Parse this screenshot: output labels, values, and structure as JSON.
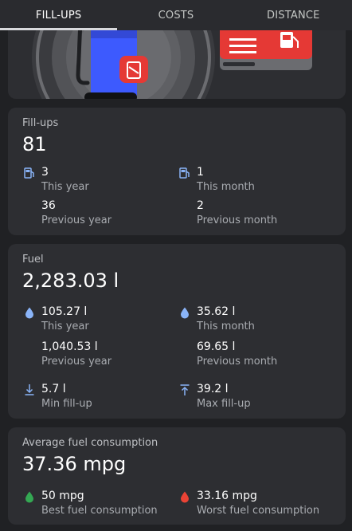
{
  "tabs": [
    {
      "label": "FILL-UPS",
      "active": true
    },
    {
      "label": "COSTS",
      "active": false
    },
    {
      "label": "DISTANCE",
      "active": false
    }
  ],
  "colors": {
    "background": "#202124",
    "card": "#2d2e32",
    "accent_blue": "#8ab4f8",
    "best": "#34a853",
    "worst": "#ea4335",
    "pump_blue": "#3d5afe",
    "red": "#e53935"
  },
  "fillups": {
    "label": "Fill-ups",
    "value": "81",
    "icon": "gas-pump-icon",
    "this_year": {
      "value": "3",
      "label": "This year"
    },
    "this_month": {
      "value": "1",
      "label": "This month"
    },
    "previous_year": {
      "value": "36",
      "label": "Previous year"
    },
    "previous_month": {
      "value": "2",
      "label": "Previous month"
    }
  },
  "fuel": {
    "label": "Fuel",
    "value": "2,283.03 l",
    "icon": "droplet-icon",
    "this_year": {
      "value": "105.27 l",
      "label": "This year"
    },
    "this_month": {
      "value": "35.62 l",
      "label": "This month"
    },
    "previous_year": {
      "value": "1,040.53 l",
      "label": "Previous year"
    },
    "previous_month": {
      "value": "69.65 l",
      "label": "Previous month"
    },
    "min": {
      "value": "5.7 l",
      "label": "Min fill-up",
      "icon": "arrow-down-to-line-icon"
    },
    "max": {
      "value": "39.2 l",
      "label": "Max fill-up",
      "icon": "arrow-up-to-line-icon"
    }
  },
  "consumption": {
    "label": "Average fuel consumption",
    "value": "37.36 mpg",
    "best": {
      "value": "50 mpg",
      "label": "Best fuel consumption",
      "icon": "droplet-green-icon"
    },
    "worst": {
      "value": "33.16 mpg",
      "label": "Worst fuel consumption",
      "icon": "droplet-red-icon"
    }
  }
}
